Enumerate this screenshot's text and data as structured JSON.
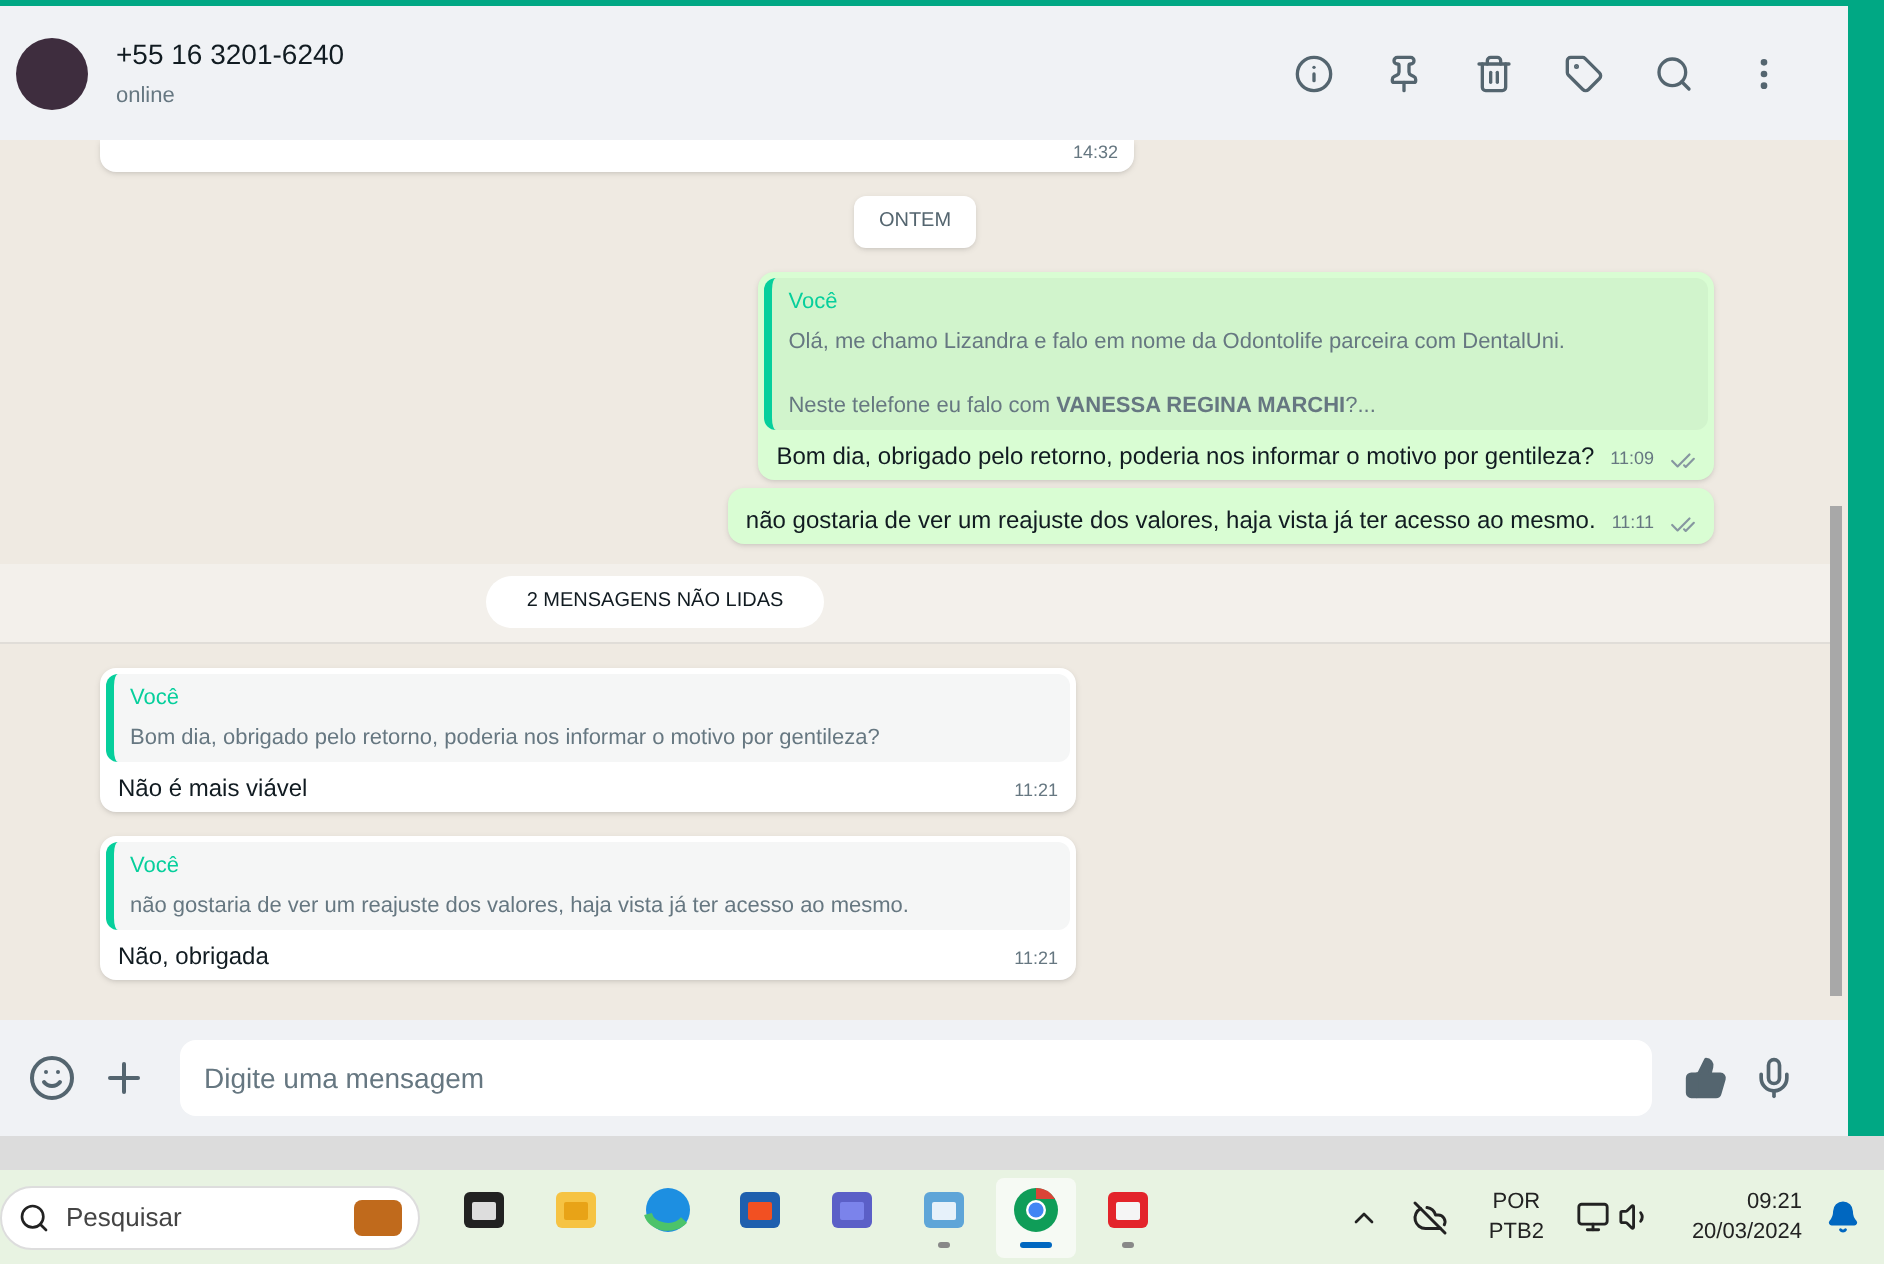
{
  "header": {
    "contact": "+55 16 3201-6240",
    "status": "online"
  },
  "messages": [
    {
      "kind": "partial",
      "time": "14:32"
    },
    {
      "kind": "date",
      "label": "ONTEM"
    },
    {
      "kind": "outgoing",
      "quote": {
        "author": "Você",
        "text": "Olá, me chamo Lizandra e falo em nome da Odontolife parceira com DentalUni.",
        "text_2": "Neste telefone eu falo com **VANESSA REGINA MARCHI**?..."
      },
      "text": "Bom dia, obrigado pelo retorno, poderia nos informar o motivo por gentileza?",
      "time": "11:09",
      "delivered": true
    },
    {
      "kind": "outgoing",
      "text": "não gostaria de ver um reajuste dos valores, haja vista já ter acesso ao mesmo.",
      "time": "11:11",
      "delivered": true
    },
    {
      "kind": "unread",
      "label": "2 MENSAGENS NÃO LIDAS"
    },
    {
      "kind": "incoming",
      "quote": {
        "author": "Você",
        "text": "Bom dia, obrigado pelo retorno, poderia nos informar o motivo por gentileza?"
      },
      "text": "Não é mais viável",
      "time": "11:21"
    },
    {
      "kind": "incoming",
      "quote": {
        "author": "Você",
        "text": "não gostaria de ver um reajuste dos valores, haja vista já ter acesso ao mesmo."
      },
      "text": "Não, obrigada",
      "time": "11:21"
    }
  ],
  "composer": {
    "placeholder": "Digite uma mensagem"
  },
  "taskbar": {
    "search_placeholder": "Pesquisar",
    "apps": [
      {
        "kind": "taskview",
        "selected": false,
        "running": false
      },
      {
        "kind": "folder",
        "selected": false,
        "running": false
      },
      {
        "kind": "edge",
        "selected": false,
        "running": false
      },
      {
        "kind": "store",
        "selected": false,
        "running": false
      },
      {
        "kind": "teams",
        "selected": false,
        "running": false
      },
      {
        "kind": "notepad",
        "selected": false,
        "running": true
      },
      {
        "kind": "chrome",
        "selected": true,
        "running": true
      },
      {
        "kind": "snip",
        "selected": false,
        "running": true
      }
    ],
    "language": "POR",
    "layout": "PTB2",
    "clock": "09:21",
    "date": "20/03/2024"
  }
}
